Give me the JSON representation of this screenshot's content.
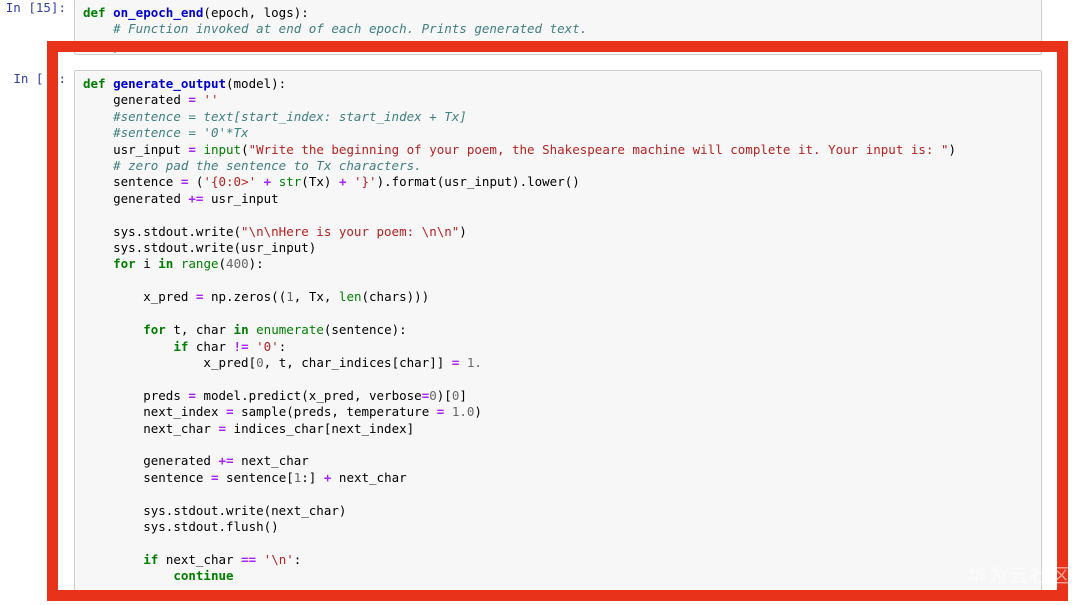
{
  "app": {
    "kind": "jupyter-notebook",
    "background": "#ffffff"
  },
  "annotation": {
    "shape": "rectangle",
    "color": "#e8321a",
    "thickness_px": 11,
    "purpose": "highlight-code-cell"
  },
  "watermark": {
    "text": "华为云社区"
  },
  "theme": {
    "cell_background": "#f7f7f7",
    "cell_border": "#cfcfcf",
    "prompt_color": "#303f9f",
    "keyword_color": "#008000",
    "function_color": "#0000cf",
    "builtin_color": "#008000",
    "string_color": "#ba2121",
    "comment_color": "#408080",
    "operator_color": "#aa22ff",
    "number_color": "#666666"
  },
  "cells": [
    {
      "id": "cell-top",
      "prompt": "In [15]:",
      "lines": [
        "def on_epoch_end(epoch, logs):",
        "    # Function invoked at end of each epoch. Prints generated text.",
        "    pass"
      ]
    },
    {
      "id": "cell-main",
      "prompt": "In [ ]:",
      "lines": [
        "def generate_output(model):",
        "    generated = ''",
        "    #sentence = text[start_index: start_index + Tx]",
        "    #sentence = '0'*Tx",
        "    usr_input = input(\"Write the beginning of your poem, the Shakespeare machine will complete it. Your input is: \")",
        "    # zero pad the sentence to Tx characters.",
        "    sentence = ('{0:0>' + str(Tx) + '}').format(usr_input).lower()",
        "    generated += usr_input",
        "",
        "    sys.stdout.write(\"\\n\\nHere is your poem: \\n\\n\")",
        "    sys.stdout.write(usr_input)",
        "    for i in range(400):",
        "",
        "        x_pred = np.zeros((1, Tx, len(chars)))",
        "",
        "        for t, char in enumerate(sentence):",
        "            if char != '0':",
        "                x_pred[0, t, char_indices[char]] = 1.",
        "",
        "        preds = model.predict(x_pred, verbose=0)[0]",
        "        next_index = sample(preds, temperature = 1.0)",
        "        next_char = indices_char[next_index]",
        "",
        "        generated += next_char",
        "        sentence = sentence[1:] + next_char",
        "",
        "        sys.stdout.write(next_char)",
        "        sys.stdout.flush()",
        "",
        "        if next_char == '\\n':",
        "            continue"
      ]
    }
  ]
}
